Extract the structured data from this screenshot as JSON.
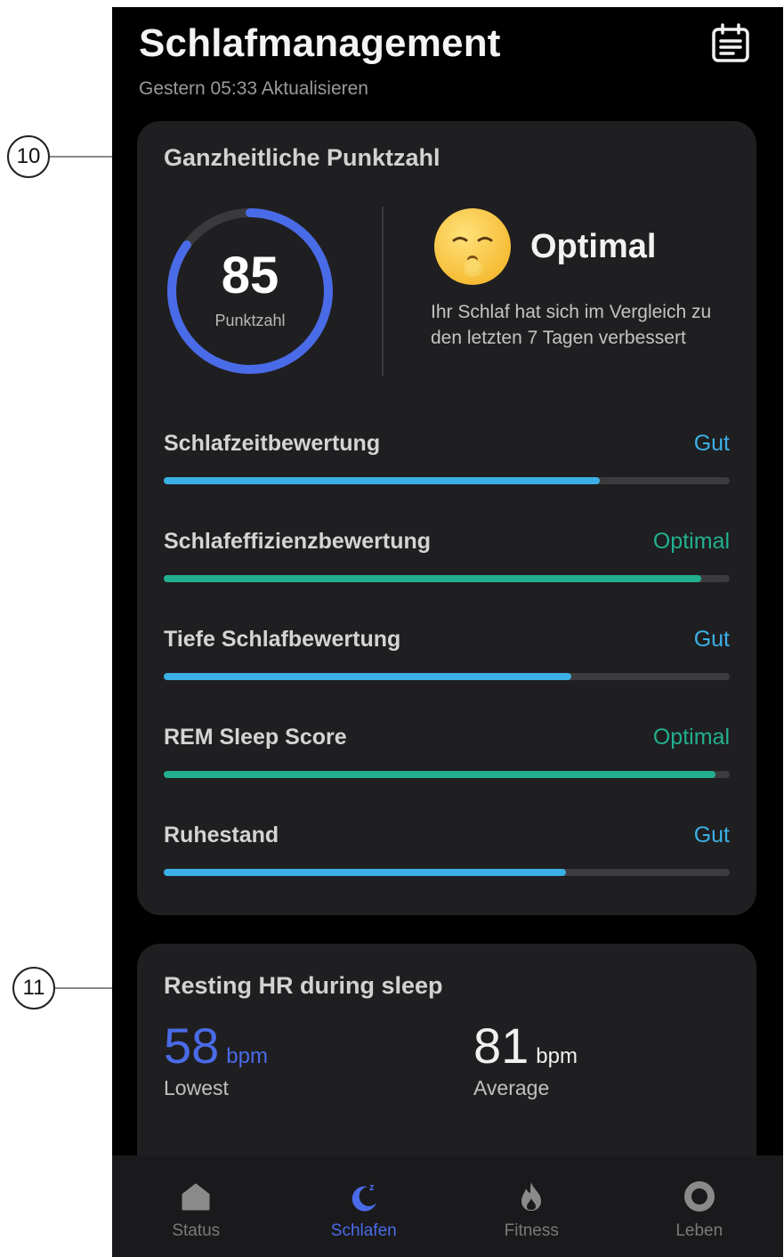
{
  "header": {
    "title": "Schlafmanagement",
    "subtitle": "Gestern 05:33 Aktualisieren"
  },
  "callouts": [
    "10",
    "11"
  ],
  "score_card": {
    "title": "Ganzheitliche Punktzahl",
    "score": "85",
    "score_label": "Punktzahl",
    "ring_fraction": 0.85,
    "ring_color": "#4a6be8",
    "status": "Optimal",
    "description": "Ihr Schlaf hat sich im Vergleich zu den letzten 7 Tagen verbessert",
    "metrics": [
      {
        "label": "Schlafzeitbewertung",
        "rating": "Gut",
        "fraction": 0.77,
        "color": "#3bb0e6"
      },
      {
        "label": "Schlafeffizienzbewertung",
        "rating": "Optimal",
        "fraction": 0.95,
        "color": "#22b08f"
      },
      {
        "label": "Tiefe Schlafbewertung",
        "rating": "Gut",
        "fraction": 0.72,
        "color": "#3bb0e6"
      },
      {
        "label": "REM Sleep Score",
        "rating": "Optimal",
        "fraction": 0.975,
        "color": "#22b08f"
      },
      {
        "label": "Ruhestand",
        "rating": "Gut",
        "fraction": 0.71,
        "color": "#3bb0e6"
      }
    ]
  },
  "hr_card": {
    "title": "Resting HR during sleep",
    "lowest": {
      "value": "58",
      "unit": "bpm",
      "label": "Lowest",
      "color": "#4a6be8"
    },
    "average": {
      "value": "81",
      "unit": "bpm",
      "label": "Average",
      "color": "#f0f0f0"
    }
  },
  "nav": [
    {
      "label": "Status",
      "icon": "house-icon",
      "active": false
    },
    {
      "label": "Schlafen",
      "icon": "moon-icon",
      "active": true
    },
    {
      "label": "Fitness",
      "icon": "flame-icon",
      "active": false
    },
    {
      "label": "Leben",
      "icon": "circle-icon",
      "active": false
    }
  ]
}
